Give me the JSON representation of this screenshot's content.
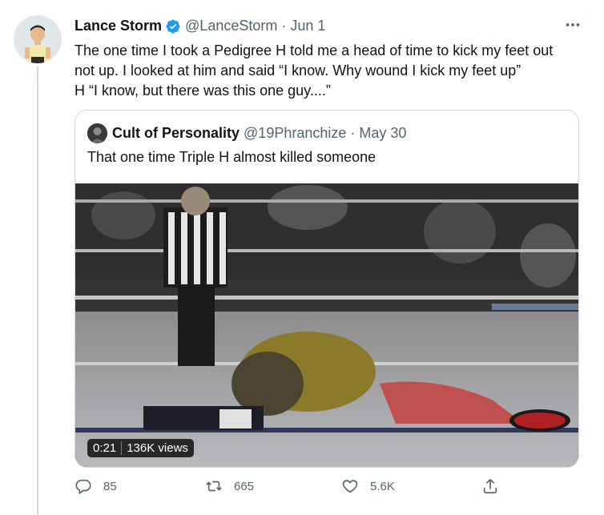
{
  "tweet": {
    "author_name": "Lance Storm",
    "handle_date": "@LanceStorm · Jun 1",
    "text_lines": [
      "The one time I took a Pedigree H told me a head of time to kick my feet out",
      "not up. I looked at him and said “I know. Why wound I kick my feet up”",
      "H “I know, but there was this one guy....”"
    ],
    "more_icon": "more-icon"
  },
  "quote": {
    "author_name": "Cult of Personality",
    "handle_date": "@19Phranchize · May 30",
    "text": "That one time Triple H almost killed someone",
    "video": {
      "duration": "0:21",
      "views": "136K views"
    }
  },
  "actions": {
    "reply_count": "85",
    "retweet_count": "665",
    "like_count": "5.6K"
  },
  "colors": {
    "accent": "#1d9bf0",
    "muted": "#536471",
    "border": "#cfd9de"
  }
}
